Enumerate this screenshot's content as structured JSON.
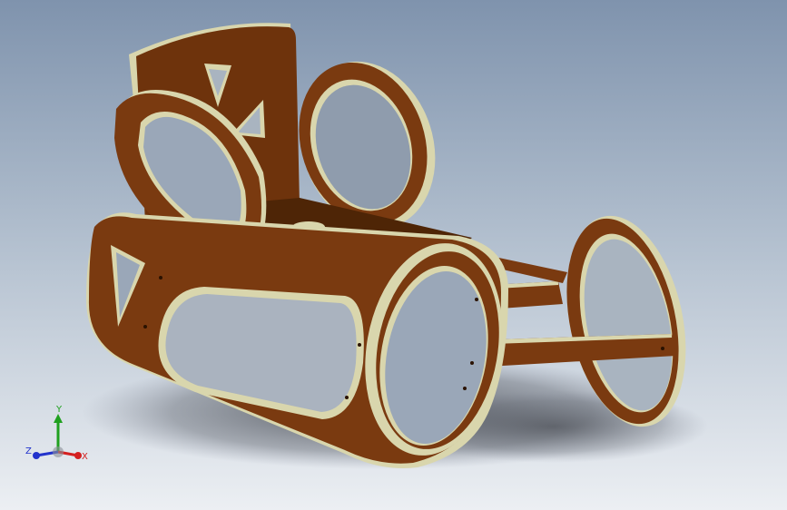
{
  "viewport": {
    "background_top": "#7f93ad",
    "background_bottom": "#eceff3"
  },
  "model": {
    "wood_color": "#7a3a10",
    "wood_dark": "#4e2506",
    "edge_color": "#d9d6ad"
  },
  "triad": {
    "x_label": "X",
    "y_label": "Y",
    "z_label": "Z",
    "x_color": "#d42020",
    "y_color": "#1fa01f",
    "z_color": "#2233cc"
  }
}
